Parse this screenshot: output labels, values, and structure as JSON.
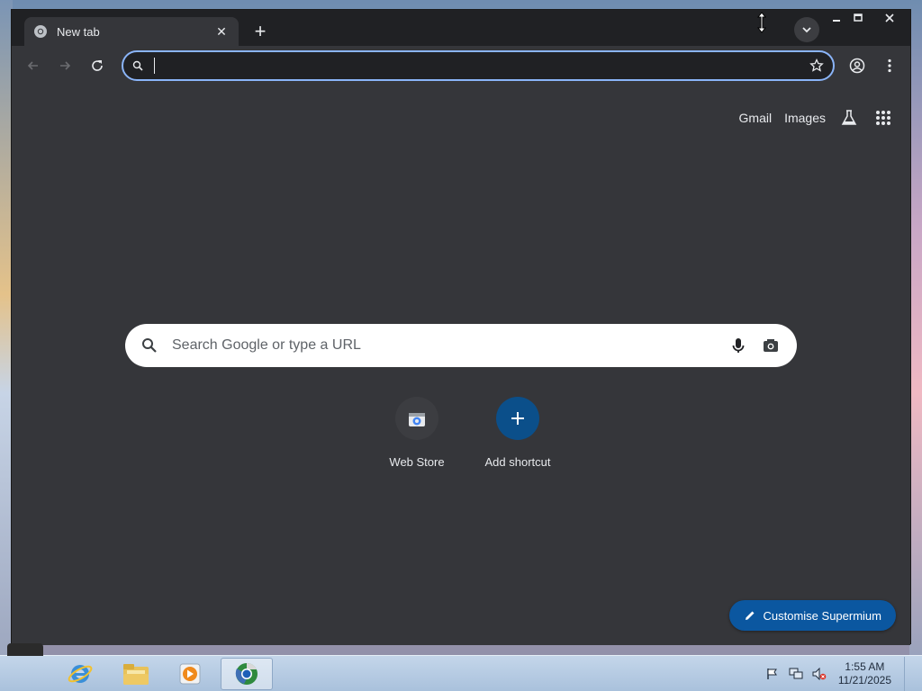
{
  "browser": {
    "tab": {
      "title": "New tab",
      "close_glyph": "✕"
    },
    "new_tab_glyph": "+",
    "omnibox": {
      "value": "",
      "placeholder": ""
    },
    "window_controls": {
      "minimize": "—",
      "maximize": "☐",
      "close": "✕"
    }
  },
  "page": {
    "top_links": {
      "gmail": "Gmail",
      "images": "Images"
    },
    "search": {
      "placeholder": "Search Google or type a URL"
    },
    "shortcuts": [
      {
        "label": "Web Store",
        "icon": "web-store-icon"
      },
      {
        "label": "Add shortcut",
        "icon": "plus-icon"
      }
    ],
    "customise_label": "Customise Supermium"
  },
  "taskbar": {
    "apps": [
      {
        "name": "internet-explorer-icon"
      },
      {
        "name": "file-explorer-icon"
      },
      {
        "name": "media-player-icon"
      },
      {
        "name": "browser-icon",
        "active": true
      }
    ],
    "clock": {
      "time": "1:55 AM",
      "date": "11/21/2025"
    }
  },
  "colors": {
    "page_bg": "#35363a",
    "frame_bg": "#202124",
    "omnibox_focus": "#8ab4f8",
    "shortcut_add_bg": "#0b4f8a",
    "customise_bg": "#0b57a0"
  }
}
